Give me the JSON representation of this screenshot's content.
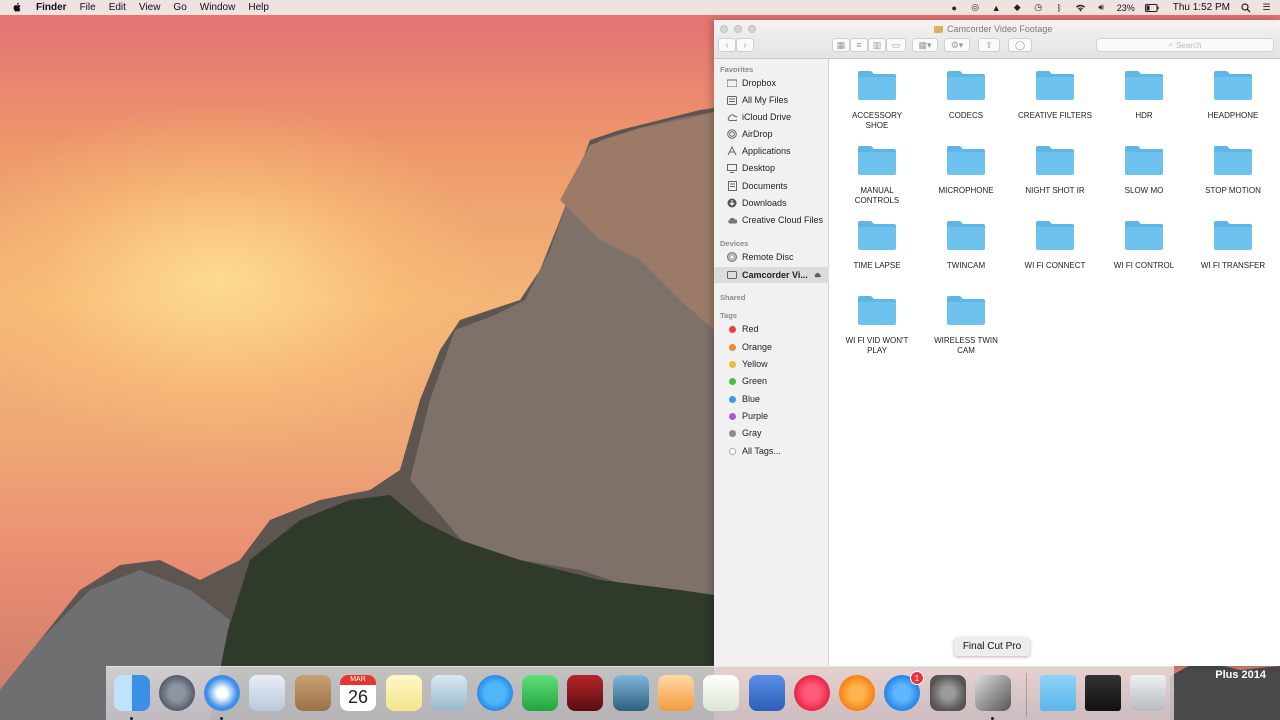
{
  "menubar": {
    "app_name": "Finder",
    "menus": [
      "File",
      "Edit",
      "View",
      "Go",
      "Window",
      "Help"
    ],
    "battery": "23%",
    "clock": "Thu 1:52 PM"
  },
  "window": {
    "title": "Camcorder Video Footage",
    "search_placeholder": "Search"
  },
  "sidebar": {
    "favorites_header": "Favorites",
    "favorites": [
      {
        "label": "Dropbox",
        "icon": "folder-icon"
      },
      {
        "label": "All My Files",
        "icon": "all-files-icon"
      },
      {
        "label": "iCloud Drive",
        "icon": "cloud-icon"
      },
      {
        "label": "AirDrop",
        "icon": "airdrop-icon"
      },
      {
        "label": "Applications",
        "icon": "applications-icon"
      },
      {
        "label": "Desktop",
        "icon": "desktop-icon"
      },
      {
        "label": "Documents",
        "icon": "documents-icon"
      },
      {
        "label": "Downloads",
        "icon": "downloads-icon"
      },
      {
        "label": "Creative Cloud Files",
        "icon": "creative-cloud-icon"
      }
    ],
    "devices_header": "Devices",
    "devices": [
      {
        "label": "Remote Disc",
        "icon": "disc-icon"
      },
      {
        "label": "Camcorder Vi...",
        "icon": "drive-icon",
        "selected": true
      }
    ],
    "shared_header": "Shared",
    "tags_header": "Tags",
    "tags": [
      {
        "label": "Red",
        "color": "#e8403a"
      },
      {
        "label": "Orange",
        "color": "#f08a2a"
      },
      {
        "label": "Yellow",
        "color": "#e9c12e"
      },
      {
        "label": "Green",
        "color": "#4cbb3b"
      },
      {
        "label": "Blue",
        "color": "#3d9ae8"
      },
      {
        "label": "Purple",
        "color": "#b159cc"
      },
      {
        "label": "Gray",
        "color": "#8a8a8a"
      }
    ],
    "all_tags": "All Tags..."
  },
  "folders": [
    [
      "ACCESSORY",
      "SHOE"
    ],
    [
      "CODECS"
    ],
    [
      "CREATIVE FILTERS"
    ],
    [
      "HDR"
    ],
    [
      "HEADPHONE"
    ],
    [
      "MANUAL",
      "CONTROLS"
    ],
    [
      "MICROPHONE"
    ],
    [
      "NIGHT SHOT IR"
    ],
    [
      "SLOW MO"
    ],
    [
      "STOP MOTION"
    ],
    [
      "TIME LAPSE"
    ],
    [
      "TWINCAM"
    ],
    [
      "WI FI CONNECT"
    ],
    [
      "WI FI CONTROL"
    ],
    [
      "WI FI TRANSFER"
    ],
    [
      "WI FI VID WON'T",
      "PLAY"
    ],
    [
      "WIRELESS TWIN",
      "CAM"
    ]
  ],
  "colors": {
    "folder": "#6ec3ee",
    "folder_tab": "#5fb6e4"
  },
  "dock": {
    "tooltip": "Final Cut Pro",
    "calendar_month": "MAR",
    "calendar_day": "26",
    "appstore_badge": "1",
    "items": [
      "finder-icon",
      "launchpad-icon",
      "safari-icon",
      "mail-icon",
      "contacts-icon",
      "calendar-icon",
      "notes-icon",
      "preview-icon",
      "messages-icon",
      "facetime-icon",
      "photo-booth-icon",
      "iphoto-icon",
      "pages-icon",
      "numbers-icon",
      "keynote-icon",
      "itunes-icon",
      "ibooks-icon",
      "app-store-icon",
      "system-preferences-icon",
      "final-cut-pro-icon",
      "downloads-folder-icon",
      "stack-icon",
      "trash-icon"
    ]
  },
  "watermark": "Plus 2014"
}
